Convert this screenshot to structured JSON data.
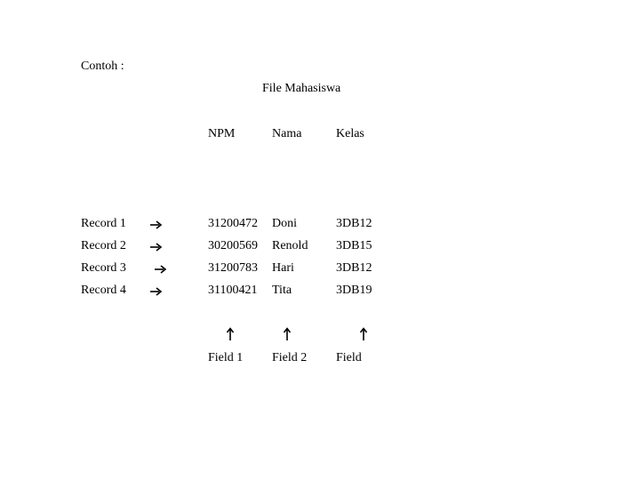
{
  "heading": "Contoh :",
  "title": "File Mahasiswa",
  "columns": [
    "NPM",
    "Nama",
    "Kelas"
  ],
  "records": [
    {
      "label": "Record 1",
      "arrow": "right-arrow-icon",
      "npm": "31200472",
      "nama": "Doni",
      "kelas": "3DB12"
    },
    {
      "label": "Record 2",
      "arrow": "right-arrow-icon",
      "npm": "30200569",
      "nama": "Renold",
      "kelas": "3DB15"
    },
    {
      "label": "Record 3",
      "arrow": "right-arrow-icon",
      "npm": "31200783",
      "nama": "Hari",
      "kelas": "3DB12"
    },
    {
      "label": "Record 4",
      "arrow": "right-arrow-icon",
      "npm": "31100421",
      "nama": "Tita",
      "kelas": "3DB19"
    }
  ],
  "field_labels": [
    "Field 1",
    "Field 2",
    "Field"
  ]
}
